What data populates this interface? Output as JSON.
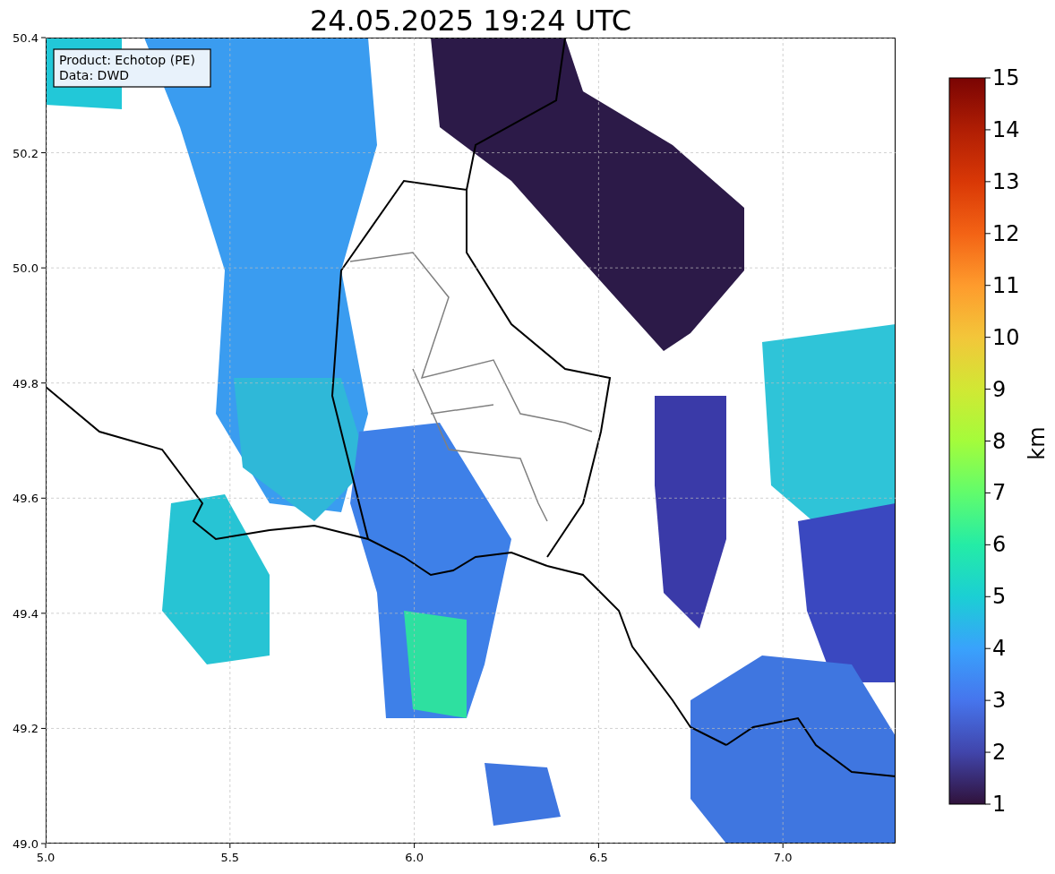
{
  "title": "24.05.2025 19:24 UTC",
  "info_box": [
    "Product: Echotop (PE)",
    "Data: DWD"
  ],
  "map": {
    "x_ticks": [
      "5.0",
      "5.5",
      "6.0",
      "6.5",
      "7.0"
    ],
    "y_ticks": [
      "50.4",
      "50.2",
      "50.0",
      "49.8",
      "49.6",
      "49.4",
      "49.2",
      "49.0"
    ]
  },
  "colorbar": {
    "ticks": [
      "15",
      "14",
      "13",
      "12",
      "11",
      "10",
      "9",
      "8",
      "7",
      "6",
      "5",
      "4",
      "3",
      "2",
      "1"
    ],
    "label": "km"
  }
}
